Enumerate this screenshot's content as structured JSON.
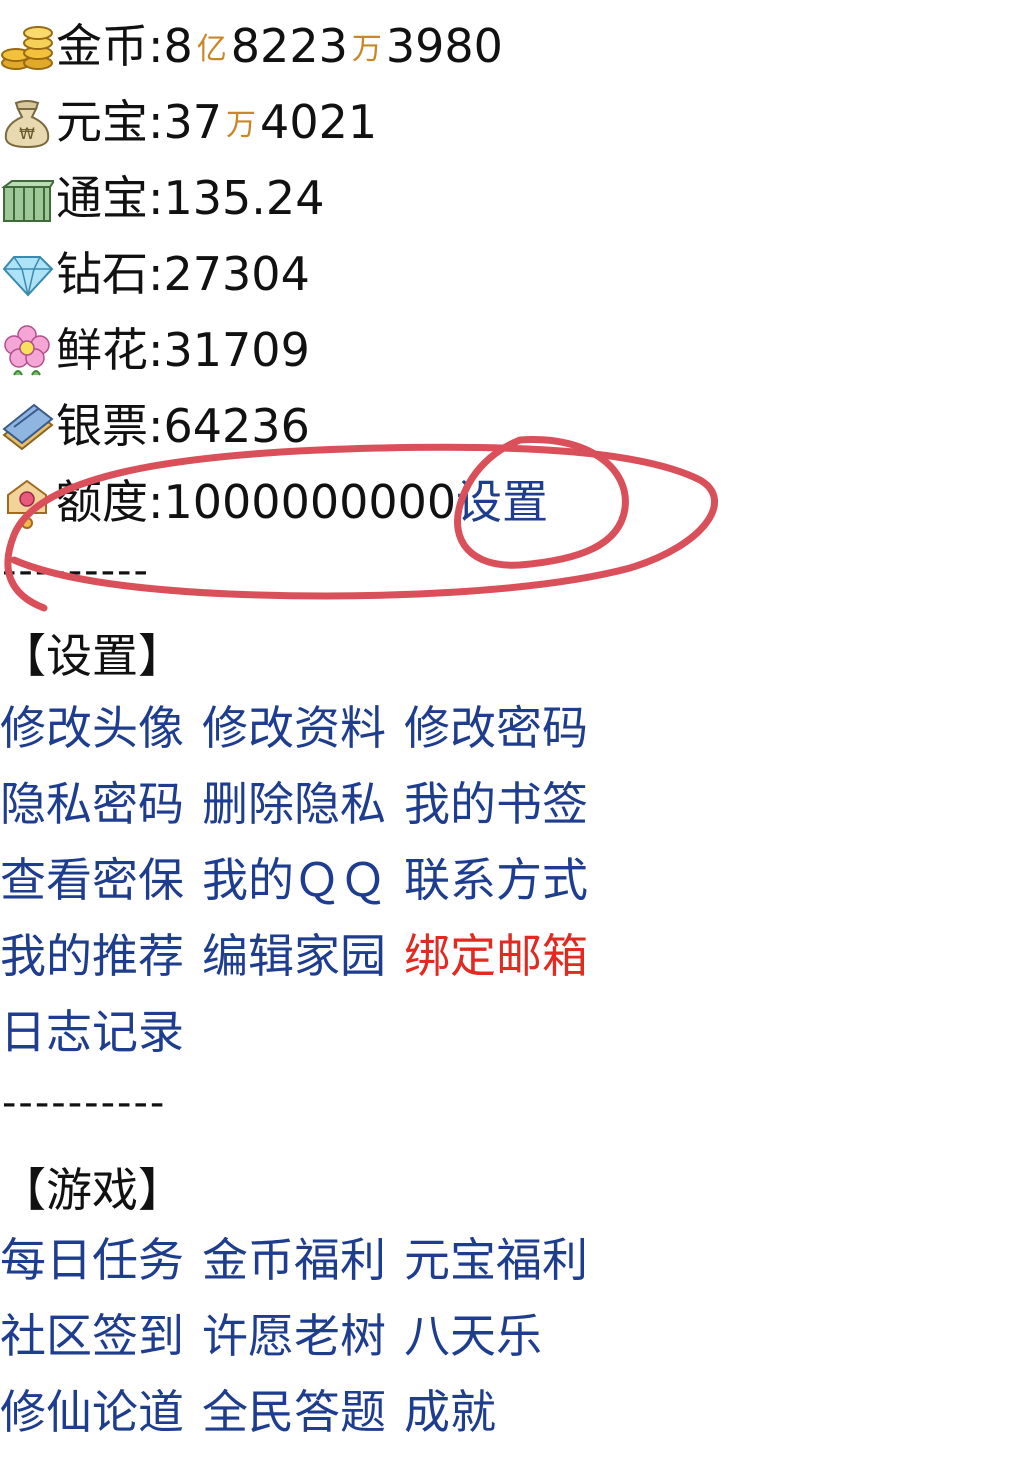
{
  "stats": {
    "gold": {
      "icon": "gold-coins-icon",
      "label": "金币:",
      "v1": "8",
      "u1": "亿",
      "v2": "8223",
      "u2": "万",
      "v3": "3980"
    },
    "yuanbao": {
      "icon": "money-bag-icon",
      "label": "元宝:",
      "v1": "37",
      "u1": "万",
      "v2": "4021"
    },
    "tongbao": {
      "icon": "cash-stack-icon",
      "label": "通宝:",
      "value": "135.24"
    },
    "diamond": {
      "icon": "diamond-icon",
      "label": "钻石:",
      "value": "27304"
    },
    "flower": {
      "icon": "flower-icon",
      "label": "鲜花:",
      "value": "31709"
    },
    "banknote": {
      "icon": "banknote-icon",
      "label": "银票:",
      "value": "64236"
    },
    "quota": {
      "icon": "quota-tag-icon",
      "label": "额度:",
      "value": "1000000000",
      "action": "设置"
    }
  },
  "divider1": "---------",
  "divider2": "----------",
  "settings": {
    "title": "【设置】",
    "rows": [
      [
        "修改头像",
        "修改资料",
        "修改密码"
      ],
      [
        "隐私密码",
        "删除隐私",
        "我的书签"
      ],
      [
        "查看密保",
        "我的ＱＱ",
        "联系方式"
      ],
      [
        "我的推荐",
        "编辑家园",
        "绑定邮箱"
      ],
      [
        "日志记录"
      ]
    ]
  },
  "games": {
    "title": "【游戏】",
    "rows": [
      [
        "每日任务",
        "金币福利",
        "元宝福利"
      ],
      [
        "社区签到",
        "许愿老树",
        "八天乐"
      ],
      [
        "修仙论道",
        "全民答题",
        "成就"
      ]
    ]
  },
  "colors": {
    "link": "#1f3d8f",
    "link_highlight": "#e02a22",
    "unit": "#c8882a",
    "annotation": "#d9505a"
  }
}
